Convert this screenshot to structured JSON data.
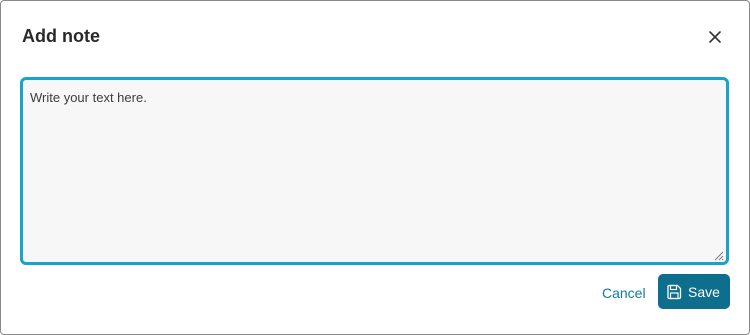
{
  "dialog": {
    "title": "Add note",
    "close_icon": "close-icon"
  },
  "note": {
    "value": "",
    "placeholder": "Write your text here."
  },
  "actions": {
    "cancel_label": "Cancel",
    "save_label": "Save",
    "save_icon": "floppy-disk-icon"
  },
  "colors": {
    "accent_border": "#1aa3c8",
    "primary_button": "#0e6e8d",
    "link": "#117aa1",
    "textarea_bg": "#f7f7f7"
  }
}
